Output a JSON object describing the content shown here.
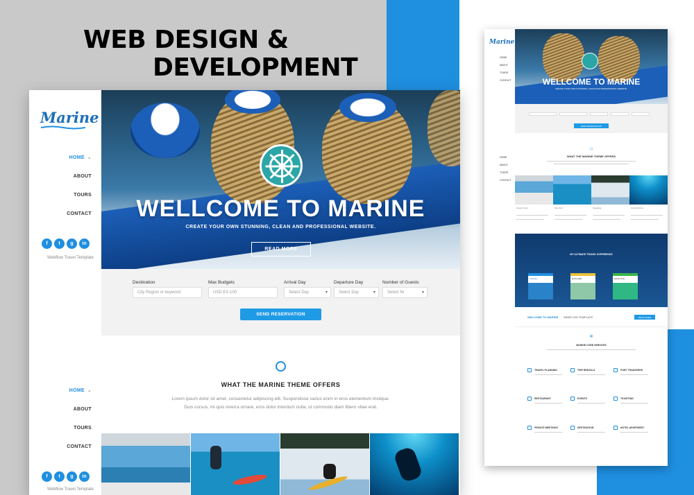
{
  "headline": {
    "line1": "WEB DESIGN &",
    "line2": "DEVELOPMENT"
  },
  "colors": {
    "accent": "#1f8fe0",
    "backdrop": "#c9c9c9",
    "button": "#1f9be6"
  },
  "main": {
    "logo": "Marine",
    "nav": {
      "home": "HOME",
      "about": "ABOUT",
      "tours": "TOURS",
      "contact": "CONTACT"
    },
    "socials": [
      "f",
      "t",
      "g",
      "in"
    ],
    "template_caption": "Webflow Travel Template",
    "hero": {
      "title": "WELLCOME TO MARINE",
      "subtitle": "CREATE YOUR OWN STUNNING, CLEAN AND PROFESSIONAL WEBSITE.",
      "button": "READ MORE"
    },
    "booking": {
      "destination_label": "Destination",
      "destination_placeholder": "City Region or keyword",
      "budget_label": "Max Budgets",
      "budget_placeholder": "USD EX.100",
      "arrival_label": "Arrival Day",
      "arrival_value": "Select Day",
      "departure_label": "Departure Day",
      "departure_value": "Select Day",
      "guests_label": "Number of Guests",
      "guests_value": "Select Nr",
      "send_button": "SEND RESERVATION"
    },
    "offers": {
      "title": "WHAT THE MARINE THEME OFFERS",
      "text1": "Lorem ipsum dolor sit amet, consectetur adipiscing elit. Suspendisse varius enim in eros elementum tristique.",
      "text2": "Duis cursus, mi quis viverra ornare, eros dolor interdum nulla, ut commodo diam libero vitae erat."
    }
  },
  "right": {
    "logo": "Marine",
    "nav": [
      "HOME",
      "ABOUT",
      "TOURS",
      "CONTACT"
    ],
    "hero_title": "WELLCOME TO MARINE",
    "hero_subtitle": "CREATE YOUR OWN STUNNING, CLEAN AND PROFESSIONAL WEBSITE.",
    "send_button": "SEND RESERVATION",
    "offers_title": "WHAT THE MARINE THEME OFFERS",
    "tour_captions": [
      "Family Tours",
      "Kite Surf",
      "Kayaking",
      "Scuba Diving"
    ],
    "banner_title": "MY ULTIMATE TRAVEL EXPERIENCE",
    "cards": [
      "TRAVEL",
      "EXPLORE",
      "HAVE FUN"
    ],
    "cta_title": "WELCOME TO MARINE",
    "cta_suffix": "WEBFLOW TEMPLATE",
    "cta_button": "READ MORE",
    "services_title": "MARINE CORE SERVICES",
    "services": [
      "TRAVEL PLANNING",
      "TRIP RENTALS",
      "PORT TRANSFERS",
      "RESTAURANT",
      "EVENTS",
      "TICKETING",
      "PRIVATE MEETINGS",
      "DESTINATION",
      "HOTEL APARTMENT"
    ]
  }
}
